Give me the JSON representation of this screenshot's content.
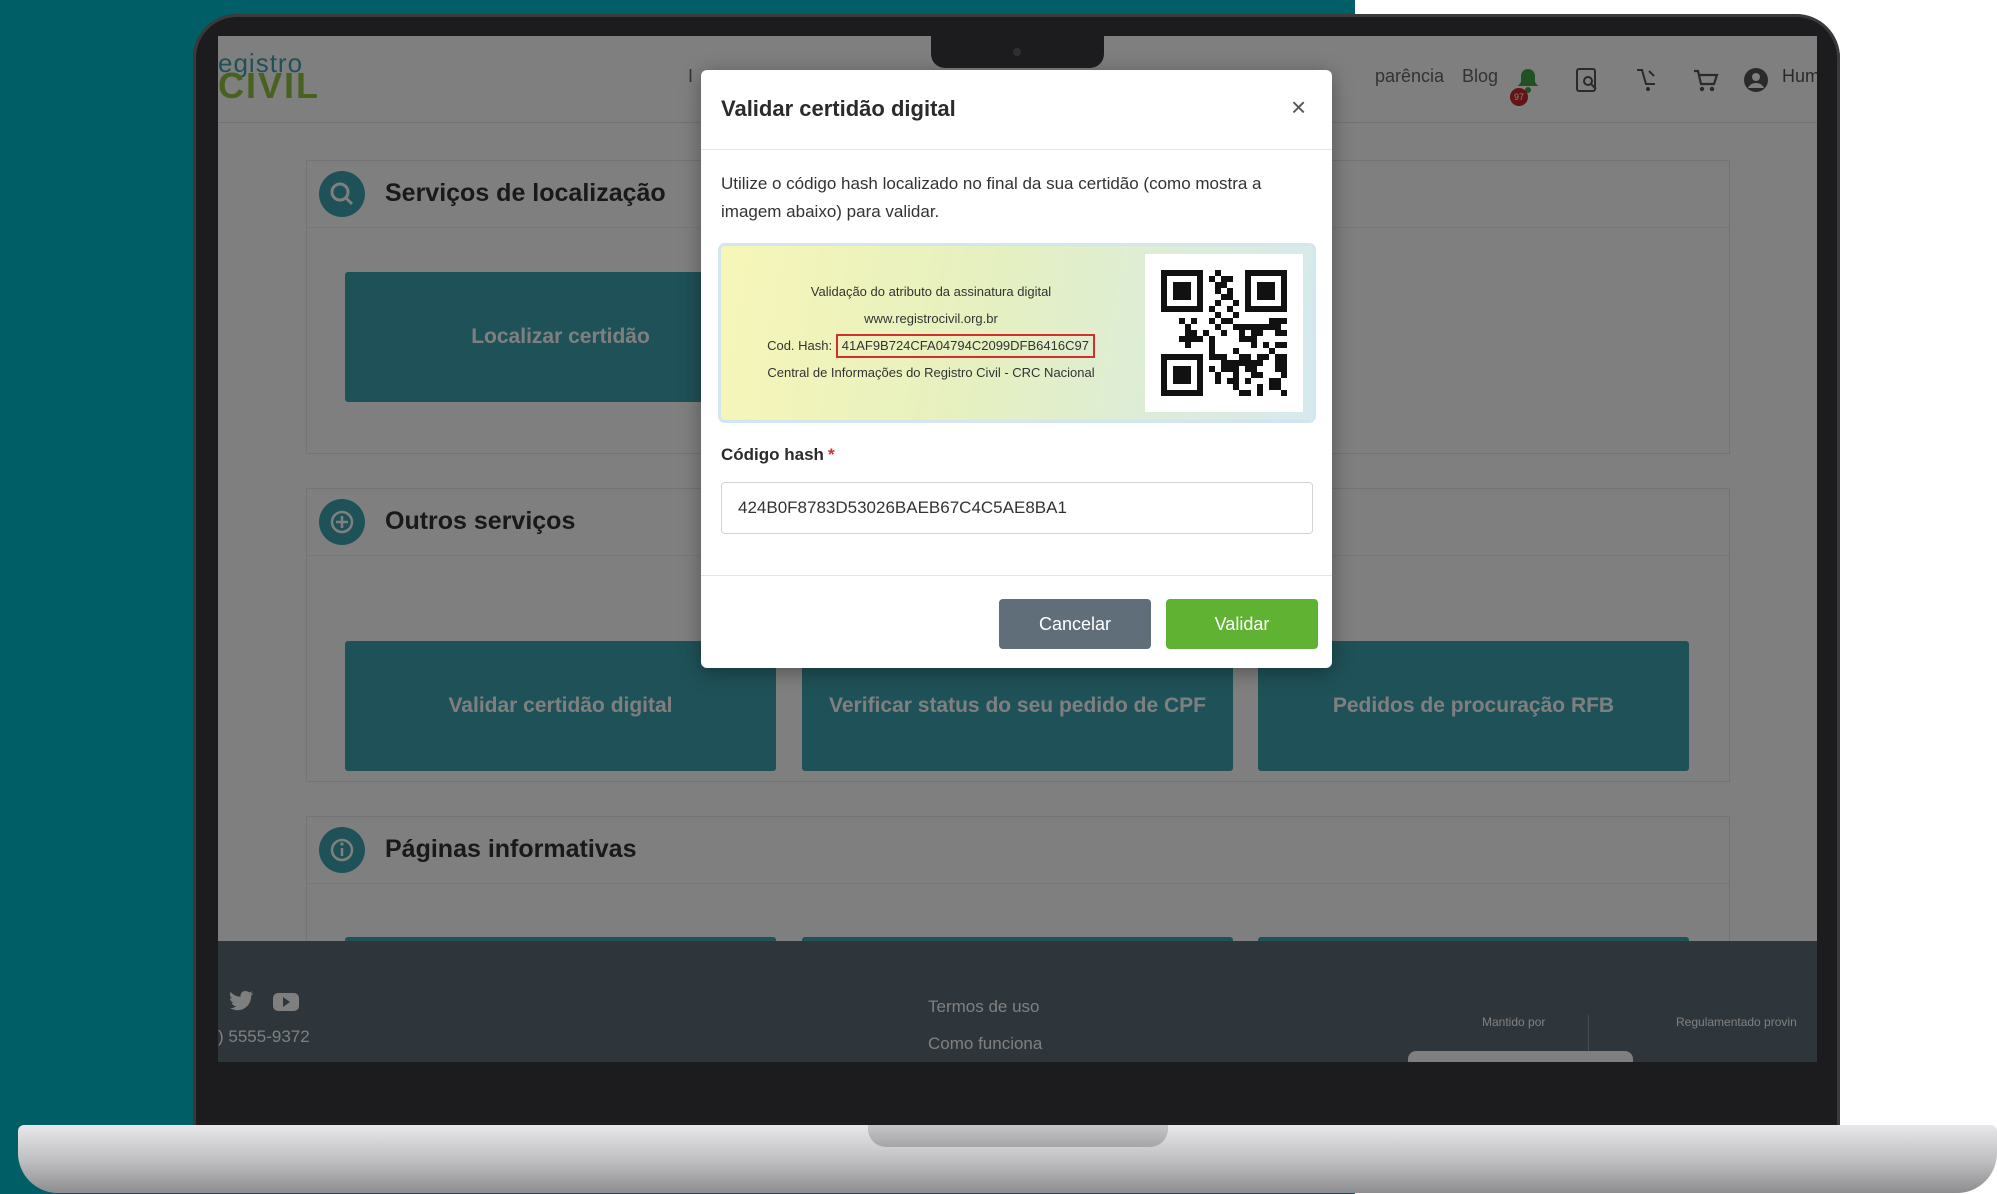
{
  "page": {
    "logo_top": "egistro",
    "logo_bottom": "CIVIL",
    "nav": {
      "link_left": "I",
      "link_transparencia": "parência",
      "link_blog": "Blog",
      "notifications_count": "97",
      "user_label": "Hum"
    },
    "sections": [
      {
        "title": "Serviços de localização",
        "tiles": [
          "Localizar certidão"
        ]
      },
      {
        "title": "Outros serviços",
        "tiles": [
          "Validar certidão digital",
          "Verificar status do seu pedido de CPF",
          "Pedidos de procuração RFB"
        ]
      },
      {
        "title": "Páginas informativas",
        "tiles": []
      }
    ],
    "footer": {
      "phone": ") 5555-9372",
      "link_terms": "Termos de uso",
      "link_how": "Como funciona",
      "maintained_by": "Mantido por",
      "regulated_by": "Regulamentado provin"
    }
  },
  "modal": {
    "title": "Validar certidão digital",
    "close_symbol": "×",
    "description": "Utilize o código hash localizado no final da sua certidão (como mostra a imagem abaixo) para validar.",
    "sample": {
      "line1": "Validação do atributo da assinatura digital",
      "line2": "www.registrocivil.org.br",
      "hash_prefix": "Cod. Hash:",
      "hash_value": "41AF9B724CFA04794C2099DFB6416C97",
      "line4": "Central de Informações do Registro Civil - CRC Nacional"
    },
    "field_label": "Código hash",
    "required_mark": "*",
    "field_value": "424B0F8783D53026BAEB67C4C5AE8BA1",
    "cancel_label": "Cancelar",
    "submit_label": "Validar"
  },
  "colors": {
    "teal_background": "#005f66",
    "primary": "#3fa3b1",
    "cancel_button": "#5f6e78",
    "submit_button": "#5fb232",
    "required": "#d32f2f"
  }
}
